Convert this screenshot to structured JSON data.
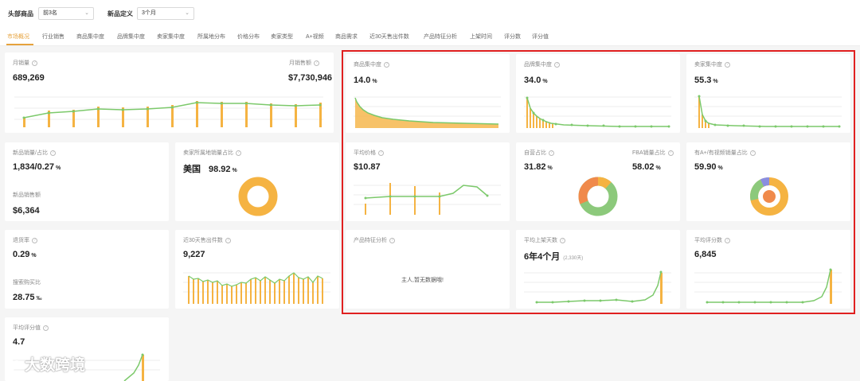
{
  "filters": {
    "top_products_label": "头部商品",
    "top_products_value": "前3名",
    "new_def_label": "新品定义",
    "new_def_value": "3个月"
  },
  "tabs": [
    "市场概况",
    "行业销售",
    "商品集中度",
    "品牌集中度",
    "卖家集中度",
    "所属地分布",
    "价格分布",
    "卖家类型",
    "A+视频",
    "商品需求",
    "近30天售出件数",
    "产品特征分析",
    "上架时间",
    "评分数",
    "评分值"
  ],
  "cards": {
    "monthly_sales": {
      "label": "月销量",
      "value": "689,269"
    },
    "monthly_revenue": {
      "label": "月销售额",
      "value": "$7,730,946"
    },
    "product_concentration": {
      "label": "商品集中度",
      "value": "14.0",
      "unit": "%"
    },
    "brand_concentration": {
      "label": "品牌集中度",
      "value": "34.0",
      "unit": "%"
    },
    "seller_concentration": {
      "label": "卖家集中度",
      "value": "55.3",
      "unit": "%"
    },
    "new_products": {
      "label": "新品销量/占比",
      "value": "1,834/0.27",
      "unit": "%",
      "sub_label": "新品销售额",
      "sub_value": "$6,364"
    },
    "seller_location": {
      "label": "卖家所属地销量占比",
      "country": "美国",
      "value": "98.92",
      "unit": "%"
    },
    "avg_price": {
      "label": "平均价格",
      "value": "$10.87"
    },
    "self_operated": {
      "label": "自营占比",
      "value": "31.82",
      "unit": "%",
      "fba_label": "FBA销量占比",
      "fba_value": "58.02",
      "fba_unit": "%"
    },
    "aplus_video": {
      "label": "有A+/有视频销量占比",
      "value": "59.90",
      "unit": "%"
    },
    "return_rate": {
      "label": "退货率",
      "value": "0.29",
      "unit": "%",
      "sub_label": "搜索购买比",
      "sub_value": "28.75",
      "sub_unit": "‰"
    },
    "sold_30d": {
      "label": "近30天售出件数",
      "value": "9,227"
    },
    "feature_analysis": {
      "label": "产品特征分析",
      "empty_text": "主人,暂无数据哦!"
    },
    "avg_listing_days": {
      "label": "平均上架天数",
      "value": "6年4个月",
      "sub": "(2,330天)"
    },
    "avg_reviews": {
      "label": "平均评分数",
      "value": "6,845"
    },
    "avg_rating": {
      "label": "平均评分值",
      "value": "4.7"
    }
  },
  "watermark": "大数跨境",
  "colors": {
    "accent": "#e6a23c",
    "bar": "#f5b342",
    "line": "#7cc96b",
    "highlight": "#e02020"
  }
}
